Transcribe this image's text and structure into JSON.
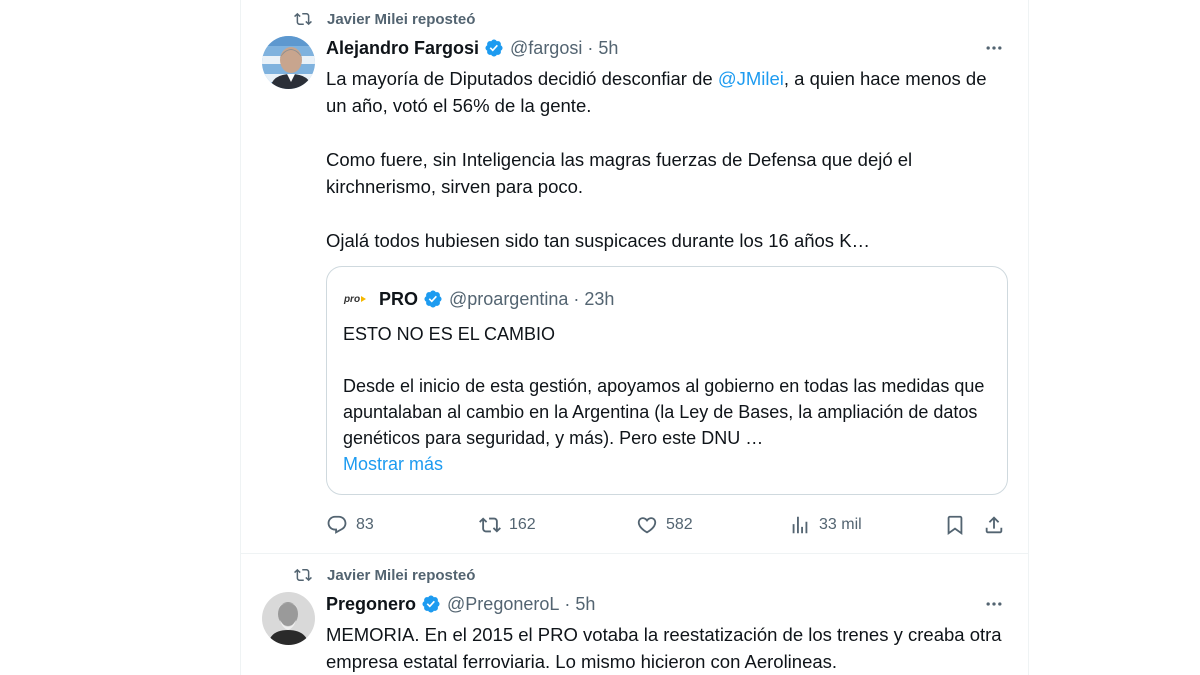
{
  "tweets": [
    {
      "repost_label": "Javier Milei reposteó",
      "author_name": "Alejandro Fargosi",
      "handle": "@fargosi",
      "separator": "·",
      "time": "5h",
      "body": {
        "p1_before": "La mayoría de Diputados decidió desconfiar de ",
        "p1_mention": "@JMilei",
        "p1_after": ", a quien hace menos de un año, votó el 56% de la gente.",
        "p2": "Como fuere, sin Inteligencia las magras fuerzas de Defensa que dejó el kirchnerismo, sirven para poco.",
        "p3": "Ojalá todos hubiesen sido tan suspicaces durante los 16 años K…"
      },
      "quote": {
        "logo_text": "pro",
        "author_name": "PRO",
        "handle": "@proargentina",
        "separator": "·",
        "time": "23h",
        "p1": "ESTO NO ES EL CAMBIO",
        "p2": "Desde el inicio de esta gestión, apoyamos al gobierno en todas las medidas que apuntalaban al cambio en la Argentina (la Ley de Bases, la ampliación de datos genéticos para seguridad, y más). Pero este DNU …",
        "show_more": "Mostrar más"
      },
      "stats": {
        "replies": "83",
        "reposts": "162",
        "likes": "582",
        "views": "33 mil"
      }
    },
    {
      "repost_label": "Javier Milei reposteó",
      "author_name": "Pregonero",
      "handle": "@PregoneroL",
      "separator": "·",
      "time": "5h",
      "body": {
        "p1": "MEMORIA.  En el 2015 el PRO votaba la reestatización de los trenes y creaba otra empresa estatal ferroviaria.  Lo mismo hicieron con Aerolineas."
      }
    }
  ],
  "colors": {
    "accent": "#1d9bf0",
    "text_primary": "#0f1419",
    "text_secondary": "#536471",
    "border": "#cfd9de",
    "divider": "#eff3f4"
  },
  "icons": {
    "repost": "repost-icon",
    "verified": "verified-badge-icon",
    "more": "more-options-icon",
    "reply": "reply-icon",
    "like": "heart-icon",
    "views": "views-chart-icon",
    "bookmark": "bookmark-icon",
    "share": "share-icon"
  }
}
